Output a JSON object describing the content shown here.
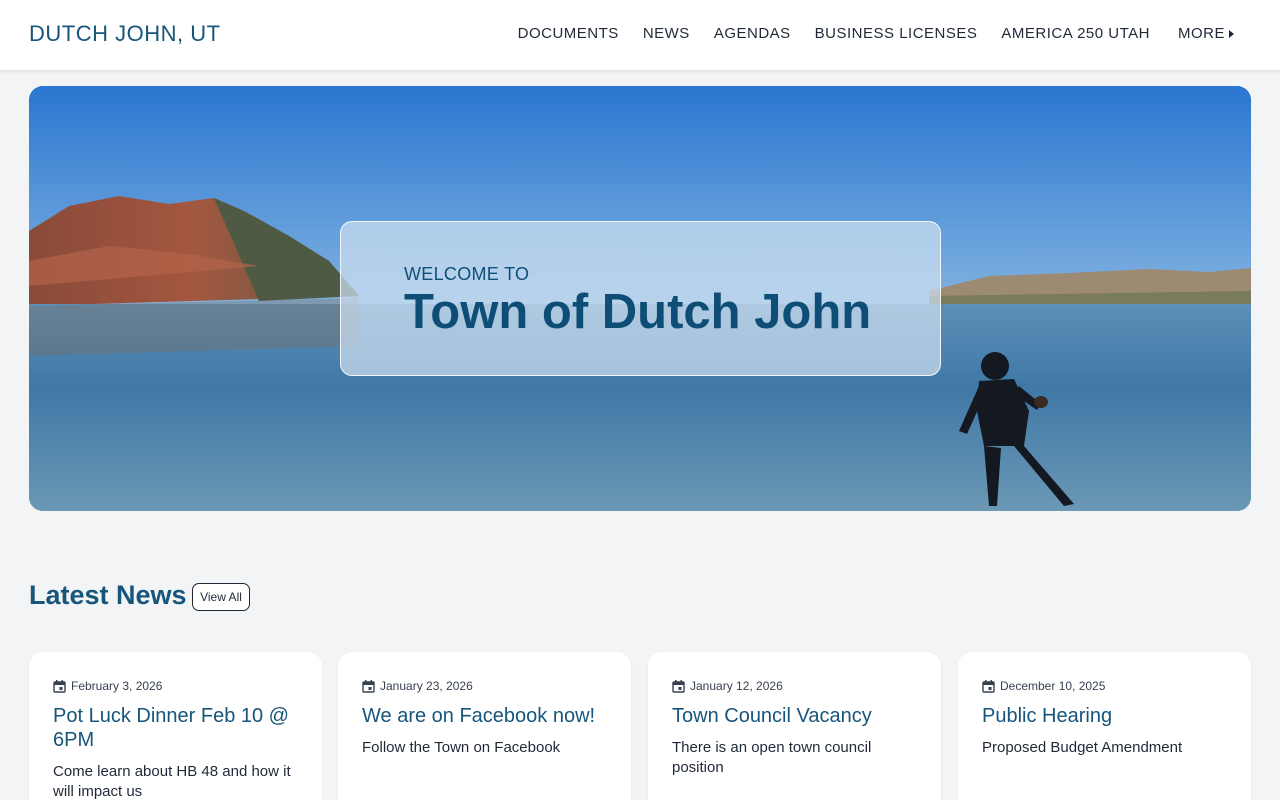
{
  "header": {
    "site_title": "DUTCH JOHN, UT",
    "nav": [
      "DOCUMENTS",
      "NEWS",
      "AGENDAS",
      "BUSINESS LICENSES",
      "AMERICA 250 UTAH"
    ],
    "more_label": "MORE"
  },
  "hero": {
    "eyebrow": "WELCOME TO",
    "title": "Town of Dutch John"
  },
  "news": {
    "heading": "Latest News",
    "view_all_label": "View All",
    "items": [
      {
        "date": "February 3, 2026",
        "title": "Pot Luck Dinner Feb 10 @ 6PM",
        "summary": "Come learn about HB 48 and how it will impact us"
      },
      {
        "date": "January 23, 2026",
        "title": "We are on Facebook now!",
        "summary": "Follow the Town on Facebook"
      },
      {
        "date": "January 12, 2026",
        "title": "Town Council Vacancy",
        "summary": "There is an open town council position"
      },
      {
        "date": "December 10, 2025",
        "title": "Public Hearing",
        "summary": "Proposed Budget Amendment"
      }
    ]
  },
  "colors": {
    "brand": "#17557a",
    "background": "#f3f4f6"
  }
}
